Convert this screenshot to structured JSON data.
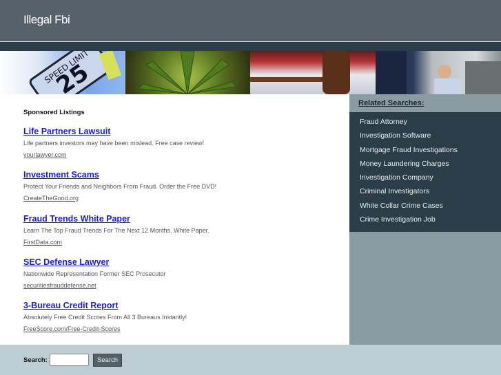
{
  "header": {
    "title": "Illegal Fbi"
  },
  "banner": {
    "images": [
      "speed-limit-sign",
      "cannabis-leaf",
      "judge-gavel",
      "police-traffic-stop"
    ]
  },
  "sponsored": {
    "heading": "Sponsored Listings",
    "ads": [
      {
        "title": "Life Partners Lawsuit",
        "desc": "Life partners investors may have been mislead. Free case review!",
        "url": "yourlawyer.com"
      },
      {
        "title": "Investment Scams",
        "desc": "Protect Your Friends and Neighbors From Fraud. Order the Free DVD!",
        "url": "CreateTheGood.org"
      },
      {
        "title": "Fraud Trends White Paper",
        "desc": "Learn The Top Fraud Trends For The Next 12 Months. White Paper.",
        "url": "FirstData.com"
      },
      {
        "title": "SEC Defense Lawyer",
        "desc": "Nationwide Representation Former SEC Prosecutor",
        "url": "securitiesfrauddefense.net"
      },
      {
        "title": "3-Bureau Credit Report",
        "desc": "Absolutely Free Credit Scores From All 3 Bureaus Instantly!",
        "url": "FreeScore.com/Free-Credit-Scores"
      }
    ]
  },
  "related": {
    "heading": "Related Searches:",
    "items": [
      "Fraud Attorney",
      "Investigation Software",
      "Mortgage Fraud Investigations",
      "Money Laundering Charges",
      "Investigation Company",
      "Criminal Investigators",
      "White Collar Crime Cases",
      "Crime Investigation Job"
    ]
  },
  "search": {
    "label": "Search:",
    "value": "",
    "button": "Search"
  },
  "colors": {
    "header": "#56626a",
    "band": "#2b3d48",
    "sidebar": "#8a9ba3",
    "footer": "#bccdd3",
    "link": "#1a1aee"
  }
}
